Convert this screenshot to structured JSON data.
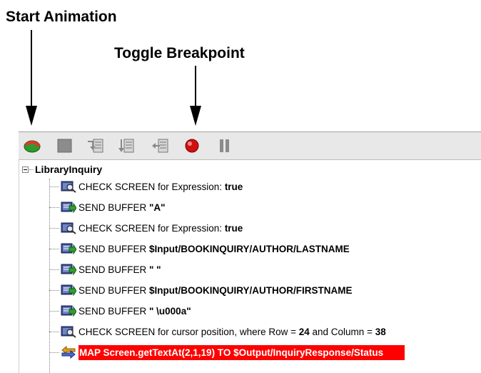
{
  "callouts": {
    "start_animation": "Start Animation",
    "toggle_breakpoint": "Toggle Breakpoint"
  },
  "toolbar": {
    "buttons": [
      {
        "name": "start-animation-button",
        "icon": "green-loop-arrow-icon"
      },
      {
        "name": "stop-button",
        "icon": "stop-square-icon"
      },
      {
        "name": "step-into-button",
        "icon": "step-into-icon"
      },
      {
        "name": "step-over-button",
        "icon": "step-over-icon"
      },
      {
        "name": "step-out-button",
        "icon": "step-out-icon"
      },
      {
        "name": "toggle-breakpoint-button",
        "icon": "red-breakpoint-icon"
      },
      {
        "name": "pause-button",
        "icon": "pause-icon"
      }
    ]
  },
  "tree": {
    "root": "LibraryInquiry",
    "items": [
      {
        "icon": "check-screen-icon",
        "text": "CHECK SCREEN for Expression: ",
        "bold": "true",
        "rest": "",
        "bold2": ""
      },
      {
        "icon": "send-buffer-icon",
        "text": "SEND BUFFER ",
        "bold": "\"A\"",
        "rest": "",
        "bold2": ""
      },
      {
        "icon": "check-screen-icon",
        "text": "CHECK SCREEN for Expression: ",
        "bold": "true",
        "rest": "",
        "bold2": ""
      },
      {
        "icon": "send-buffer-icon",
        "text": "SEND BUFFER ",
        "bold": "$Input/BOOKINQUIRY/AUTHOR/LASTNAME",
        "rest": "",
        "bold2": ""
      },
      {
        "icon": "send-buffer-icon",
        "text": "SEND BUFFER ",
        "bold": "\" \"",
        "rest": "",
        "bold2": ""
      },
      {
        "icon": "send-buffer-icon",
        "text": "SEND BUFFER ",
        "bold": "$Input/BOOKINQUIRY/AUTHOR/FIRSTNAME",
        "rest": "",
        "bold2": ""
      },
      {
        "icon": "send-buffer-icon",
        "text": "SEND BUFFER ",
        "bold": "\" \\u000a\"",
        "rest": "",
        "bold2": ""
      },
      {
        "icon": "check-screen-icon",
        "text": "CHECK SCREEN for cursor position, where Row = ",
        "bold": "24",
        "rest": " and Column = ",
        "bold2": "38"
      },
      {
        "icon": "map-icon",
        "text": "MAP Screen.getTextAt(2,1,19) TO $Output/InquiryResponse/Status",
        "bold": "",
        "rest": "",
        "bold2": "",
        "selected": true
      }
    ]
  },
  "colors": {
    "selection": "#ff0000",
    "toolbar": "#e8e8e8"
  }
}
